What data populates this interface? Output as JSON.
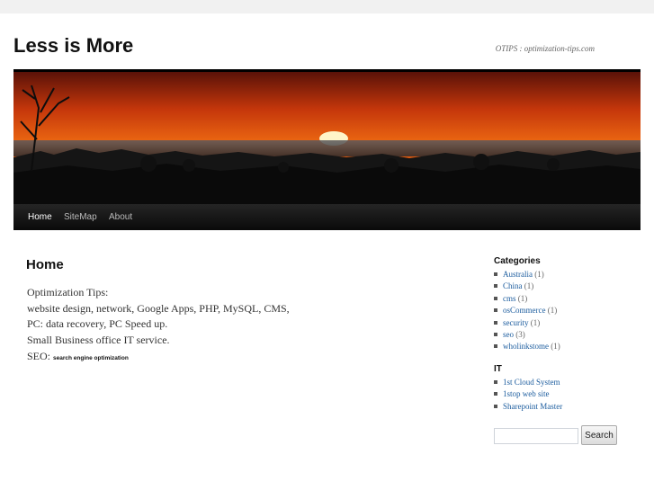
{
  "site": {
    "title": "Less is More",
    "description": "OTIPS : optimization-tips.com"
  },
  "nav": {
    "items": [
      {
        "label": "Home",
        "active": true
      },
      {
        "label": "SiteMap",
        "active": false
      },
      {
        "label": "About",
        "active": false
      }
    ]
  },
  "content": {
    "title": "Home",
    "lines": [
      "Optimization Tips:",
      "website design, network, Google Apps, PHP, MySQL, CMS,",
      "PC: data recovery, PC Speed up.",
      "Small Business office IT service."
    ],
    "seo_prefix": "SEO:",
    "seo_link": "search engine optimization"
  },
  "sidebar": {
    "categories_title": "Categories",
    "categories": [
      {
        "name": "Australia",
        "count": "(1)"
      },
      {
        "name": "China",
        "count": "(1)"
      },
      {
        "name": "cms",
        "count": "(1)"
      },
      {
        "name": "osCommerce",
        "count": "(1)"
      },
      {
        "name": "security",
        "count": "(1)"
      },
      {
        "name": "seo",
        "count": "(3)"
      },
      {
        "name": "wholinkstome",
        "count": "(1)"
      }
    ],
    "it_title": "IT",
    "it_links": [
      {
        "name": "1st Cloud System"
      },
      {
        "name": "1stop web site"
      },
      {
        "name": "Sharepoint Master"
      }
    ],
    "search": {
      "value": "",
      "button_label": "Search"
    }
  },
  "colors": {
    "link": "#1b5c9e",
    "nav_bg": "#111111",
    "banner_sky": "#e8540f"
  }
}
